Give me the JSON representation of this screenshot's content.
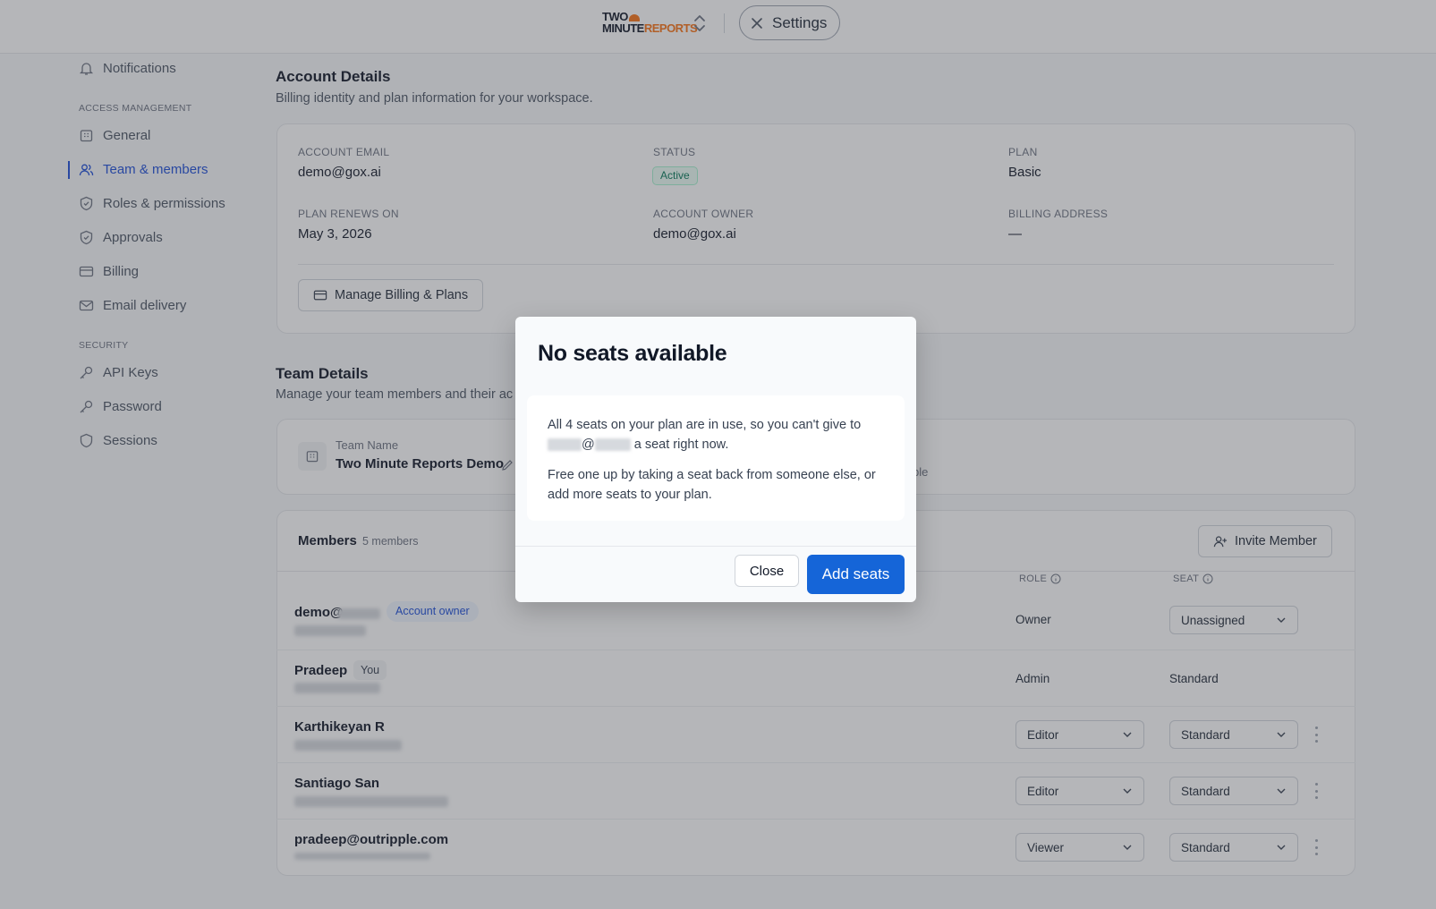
{
  "header": {
    "logo_line1": "TWO",
    "logo_line2_a": "MINUTE",
    "logo_line2_b": "REPORTS",
    "settings_label": "Settings"
  },
  "sidebar": {
    "notifications": "Notifications",
    "section_access": "ACCESS MANAGEMENT",
    "general": "General",
    "team_members": "Team & members",
    "roles": "Roles & permissions",
    "approvals": "Approvals",
    "billing": "Billing",
    "email_delivery": "Email delivery",
    "section_security": "SECURITY",
    "api_keys": "API Keys",
    "password": "Password",
    "sessions": "Sessions"
  },
  "account": {
    "title": "Account Details",
    "subtitle": "Billing identity and plan information for your workspace.",
    "email_label": "ACCOUNT EMAIL",
    "email_value": "demo@gox.ai",
    "status_label": "STATUS",
    "status_value": "Active",
    "plan_label": "PLAN",
    "plan_value": "Basic",
    "renews_label": "PLAN RENEWS ON",
    "renews_value": "May 3, 2026",
    "owner_label": "ACCOUNT OWNER",
    "owner_value": "demo@gox.ai",
    "address_label": "BILLING ADDRESS",
    "address_value": "—",
    "manage_button": "Manage Billing & Plans"
  },
  "team": {
    "title": "Team Details",
    "subtitle": "Manage your team members and their ac",
    "name_label": "Team Name",
    "name_value": "Two Minute Reports Demo",
    "partial_text": "ble"
  },
  "members": {
    "title": "Members",
    "count": "5 members",
    "invite_button": "Invite Member",
    "col_role": "ROLE",
    "col_seat": "SEAT",
    "rows": [
      {
        "name": "demo@",
        "tag": "Account owner",
        "role": "Owner",
        "seat": "Unassigned"
      },
      {
        "name": "Pradeep",
        "tag": "You",
        "role": "Admin",
        "seat": "Standard"
      },
      {
        "name": "Karthikeyan R",
        "role": "Editor",
        "seat": "Standard"
      },
      {
        "name": "Santiago San",
        "role": "Editor",
        "seat": "Standard"
      },
      {
        "name": "pradeep@outripple.com",
        "role": "Viewer",
        "seat": "Standard"
      }
    ]
  },
  "modal": {
    "title": "No seats available",
    "body_line1": "All 4 seats on your plan are in use, so you can't give to",
    "body_at": "@",
    "body_line2_tail": "a seat right now.",
    "body_para2": "Free one up by taking a seat back from someone else, or add more seats to your plan.",
    "close_button": "Close",
    "primary_button": "Add seats"
  }
}
